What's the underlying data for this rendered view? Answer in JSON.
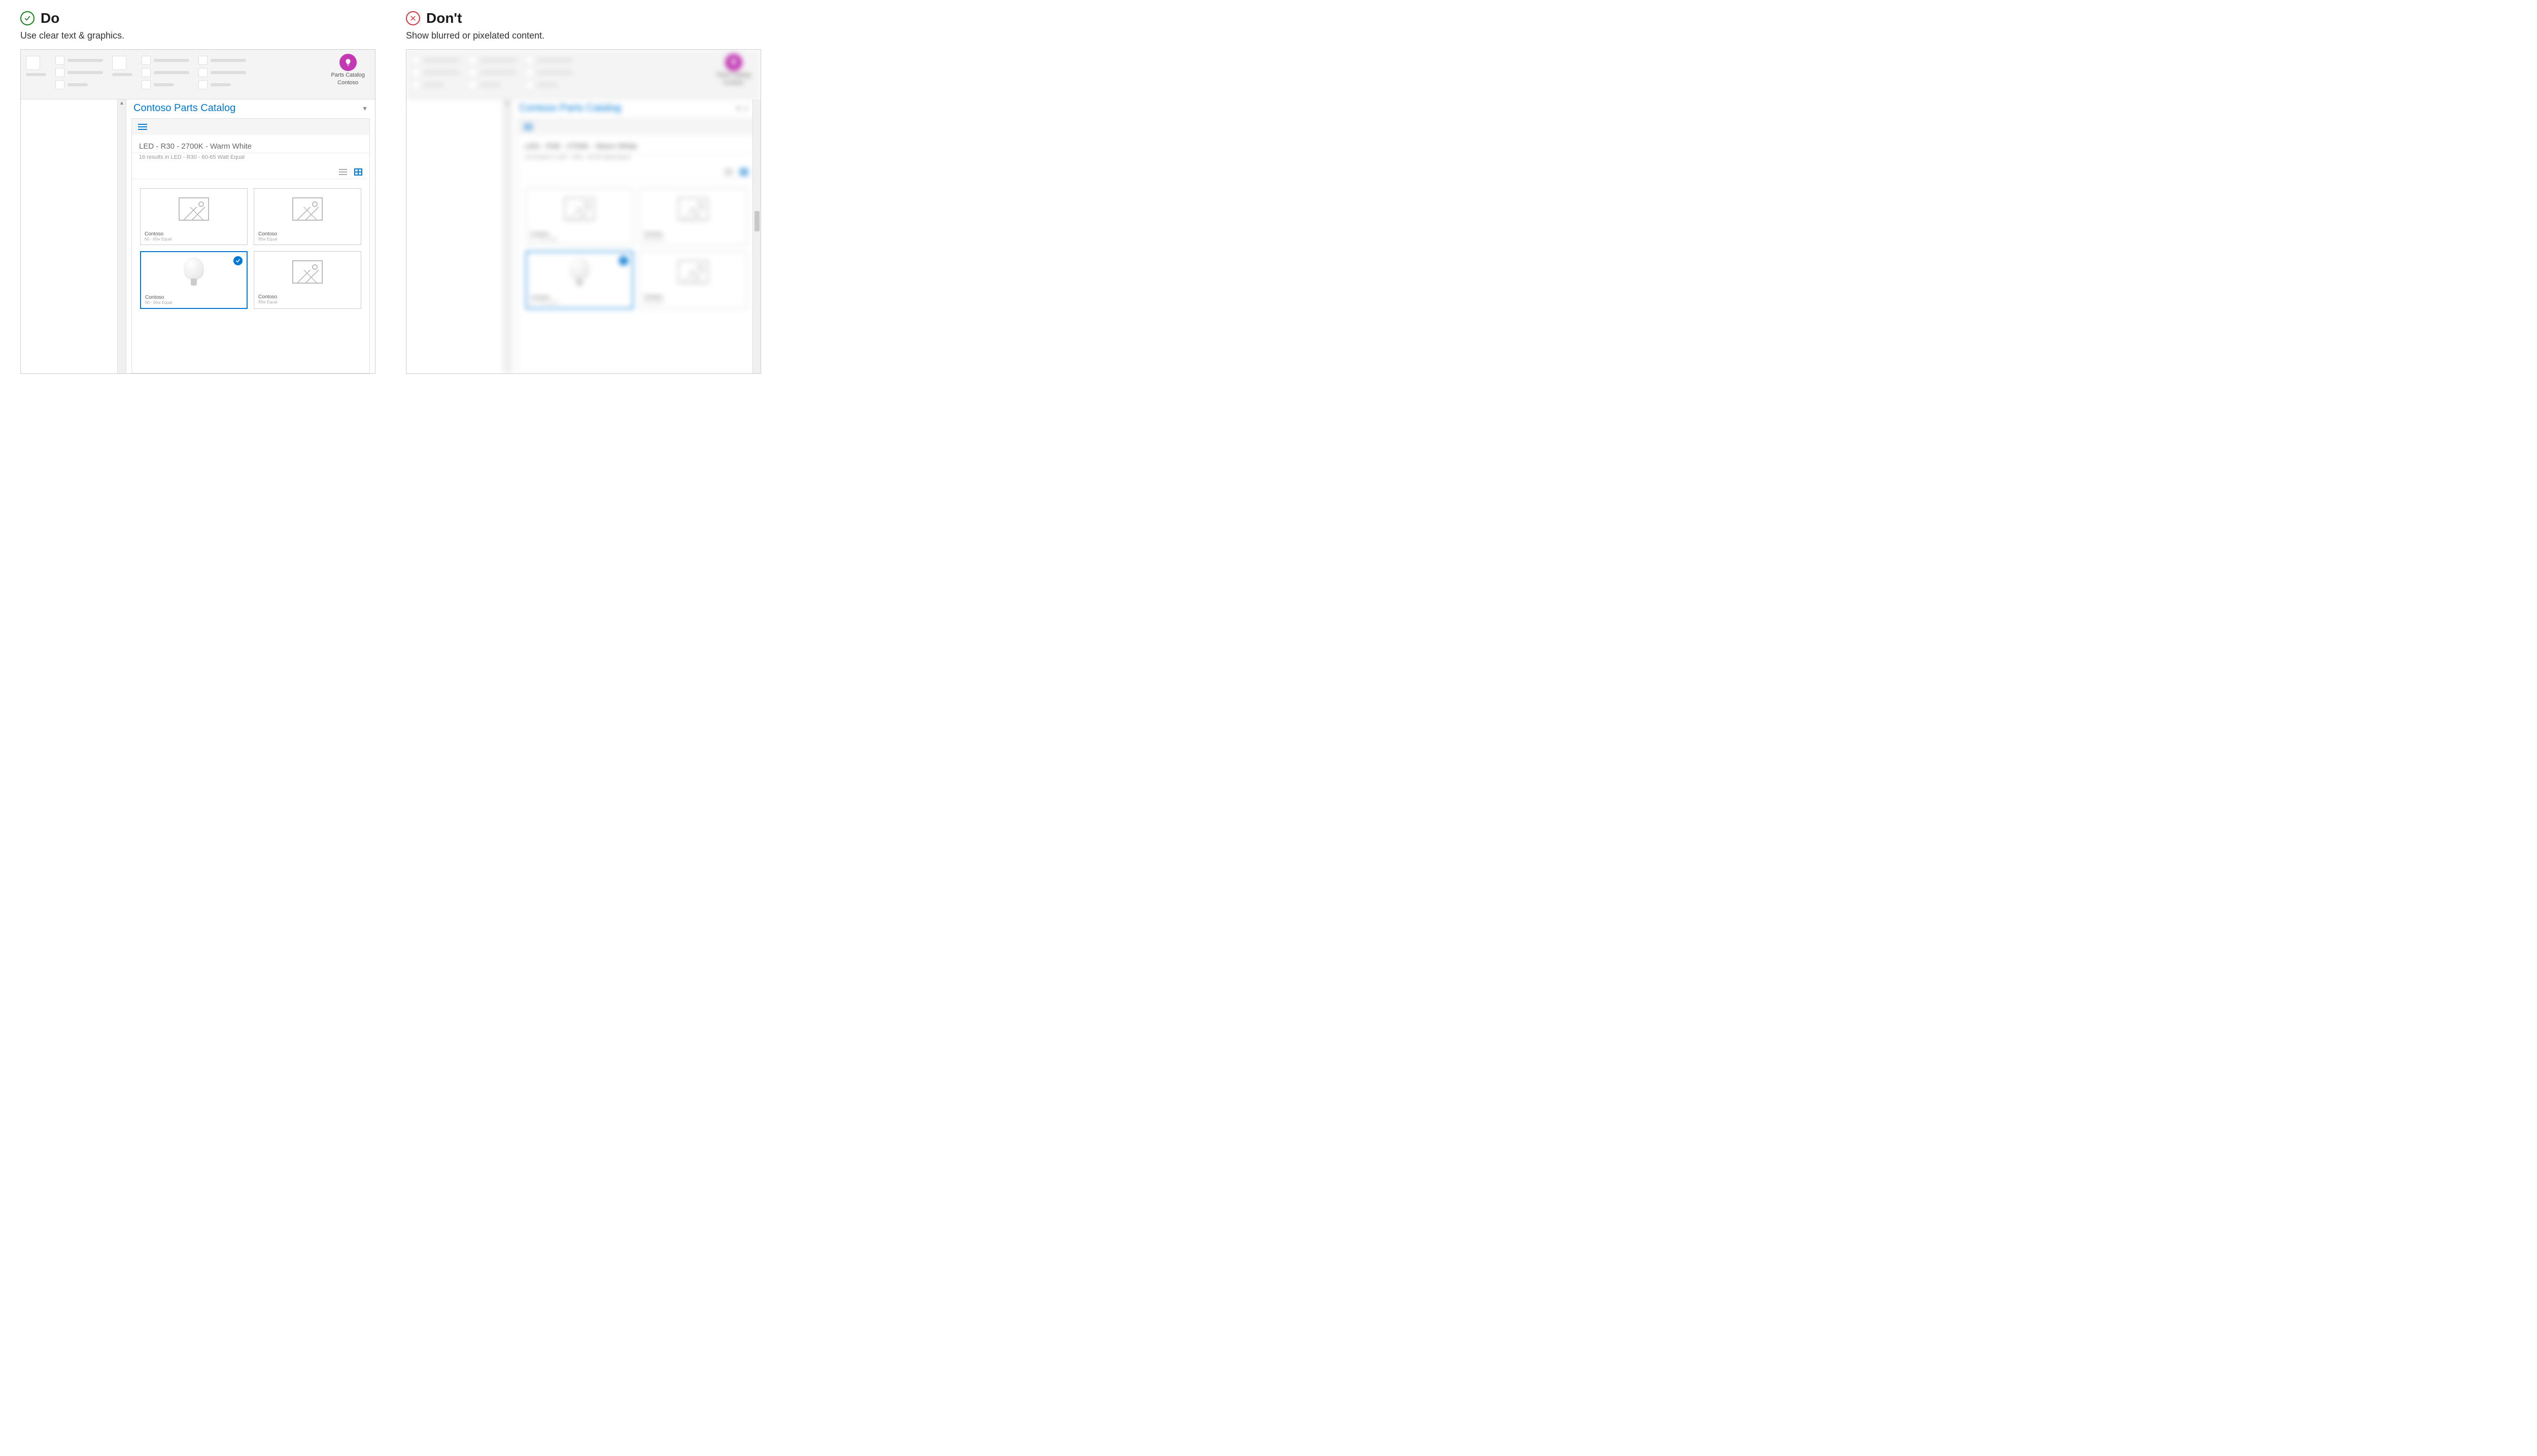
{
  "do": {
    "heading": "Do",
    "subtitle": "Use clear text & graphics."
  },
  "dont": {
    "heading": "Don't",
    "subtitle": "Show blurred or pixelated content."
  },
  "ribbon": {
    "addin_label_1": "Parts Catalog",
    "addin_label_2": "Contoso"
  },
  "taskpane": {
    "title": "Contoso Parts Catalog",
    "breadcrumb": "LED - R30 - 2700K - Warm White",
    "results": "16 results in LED - R30 - 60-65 Watt Equal",
    "cards": [
      {
        "label": "Contoso",
        "sub": "60 - 65w Equal",
        "selected": false,
        "image": "placeholder"
      },
      {
        "label": "Contoso",
        "sub": "85w Equal",
        "selected": false,
        "image": "placeholder"
      },
      {
        "label": "Contoso",
        "sub": "60 - 65w Equal",
        "selected": true,
        "image": "bulb"
      },
      {
        "label": "Contoso",
        "sub": "85w Equal",
        "selected": false,
        "image": "placeholder"
      }
    ]
  }
}
